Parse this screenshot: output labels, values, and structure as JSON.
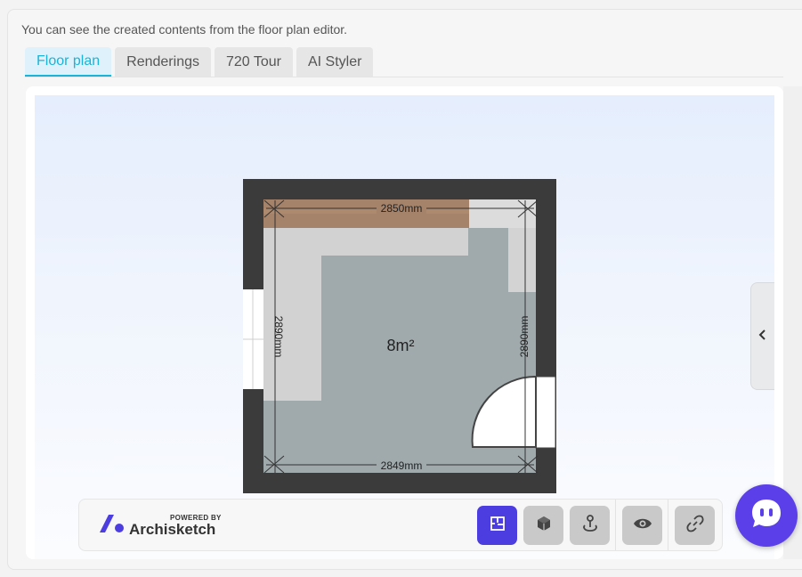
{
  "intro_text": "You can see the created contents from the floor plan editor.",
  "tabs": [
    {
      "label": "Floor plan",
      "active": true
    },
    {
      "label": "Renderings",
      "active": false
    },
    {
      "label": "720 Tour",
      "active": false
    },
    {
      "label": "AI Styler",
      "active": false
    }
  ],
  "floor_plan": {
    "top_dimension": "2850mm",
    "bottom_dimension": "2849mm",
    "left_dimension": "2890mm",
    "right_dimension": "2890mm",
    "area": "8m²"
  },
  "toolbar": {
    "powered_by": "POWERED BY",
    "brand": "Archisketch",
    "buttons": [
      {
        "name": "floor-plan-view",
        "icon": "floor-plan-icon",
        "active": true
      },
      {
        "name": "3d-view",
        "icon": "cube-icon",
        "active": false
      },
      {
        "name": "walkthrough-view",
        "icon": "person-pin-icon",
        "active": false
      },
      {
        "name": "preview",
        "icon": "eye-icon",
        "active": false
      },
      {
        "name": "share-link",
        "icon": "link-icon",
        "active": false
      }
    ]
  },
  "colors": {
    "accent": "#1bb3d8",
    "primary": "#4c3de0",
    "chat": "#5b3fe8",
    "floor": "#a0aaad",
    "wall": "#3c3c3c"
  }
}
